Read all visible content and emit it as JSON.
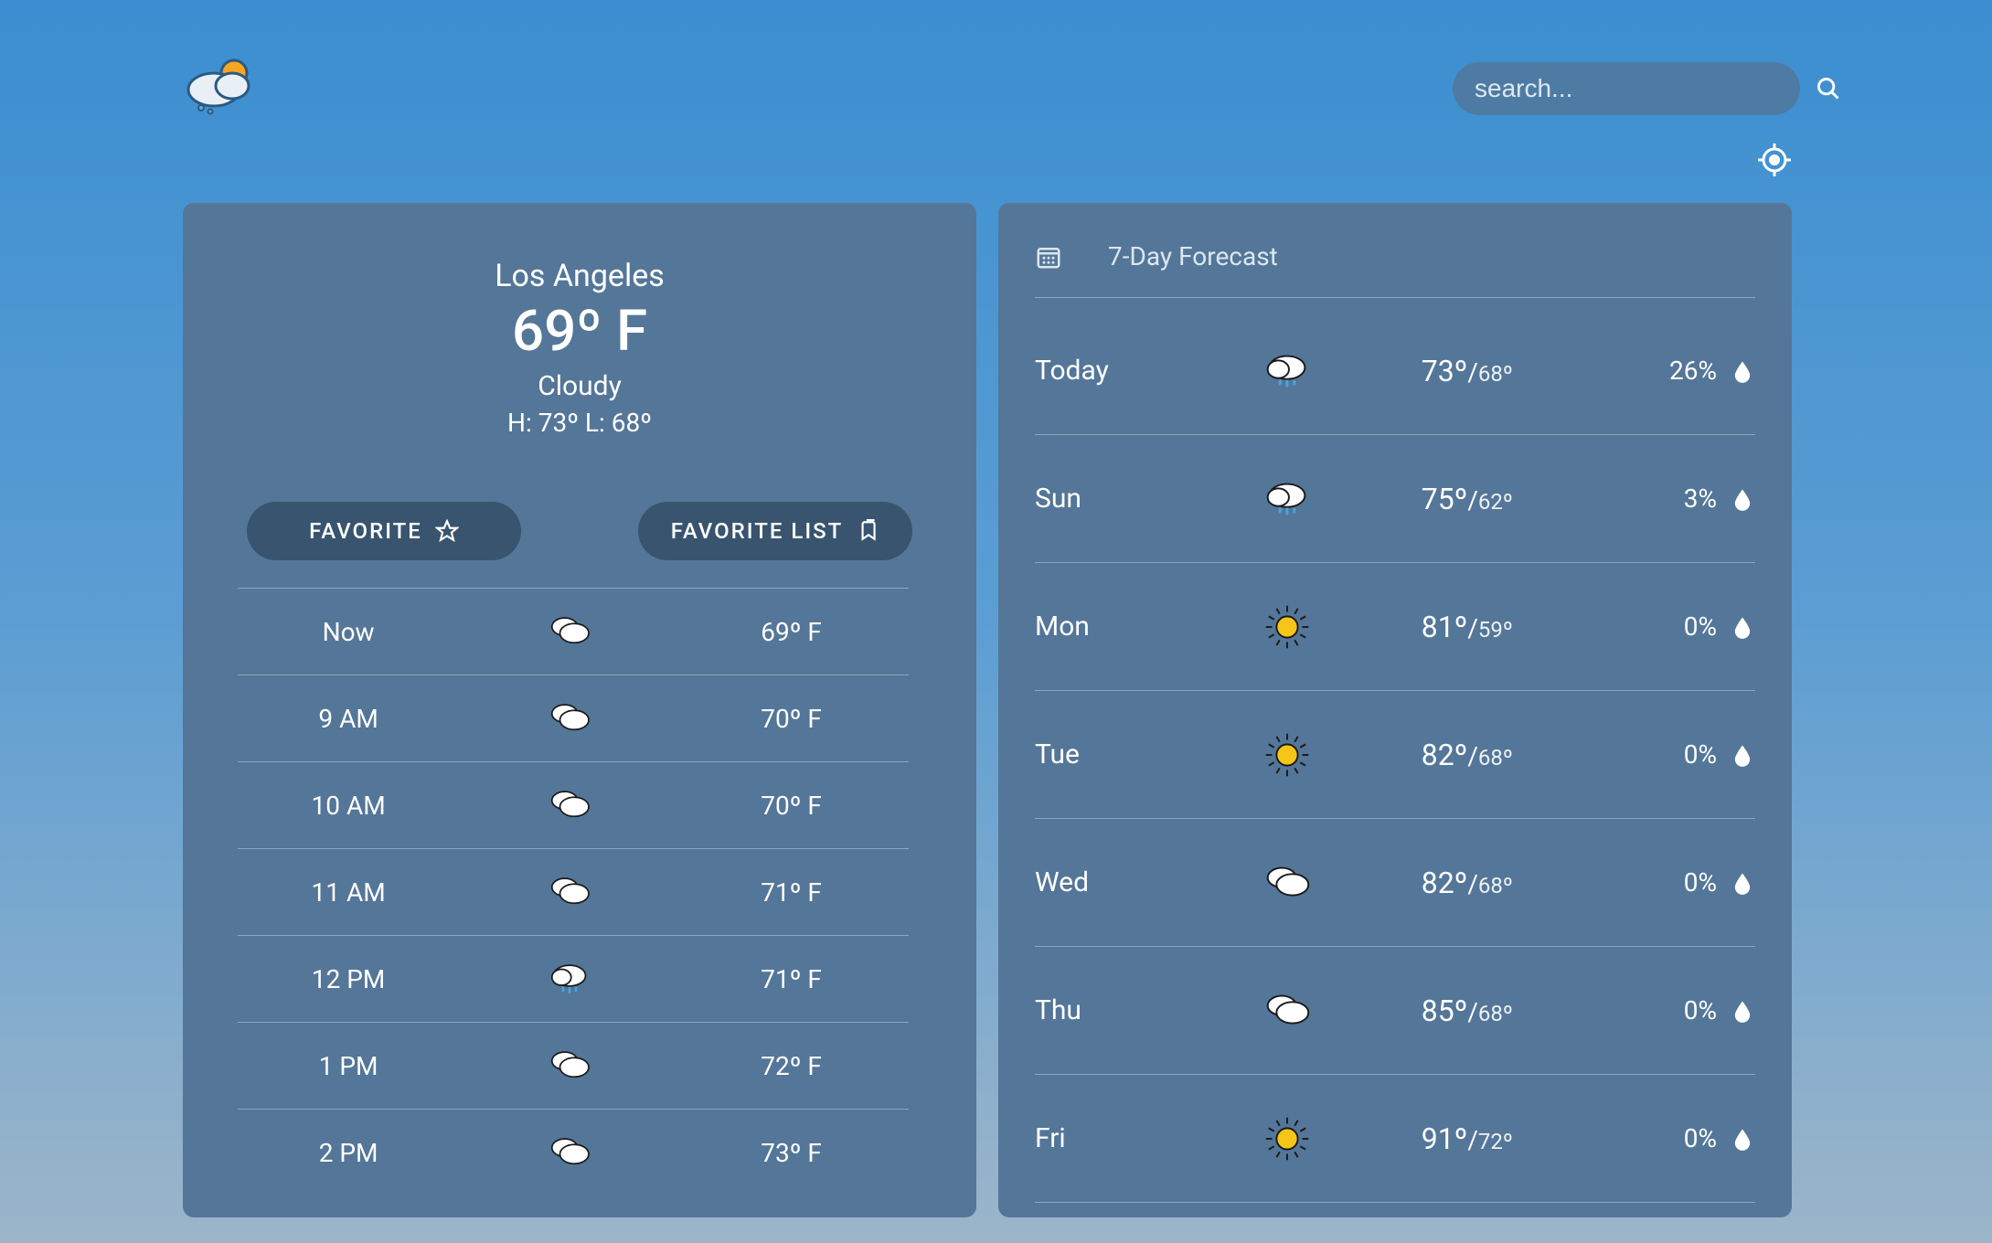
{
  "search": {
    "placeholder": "search..."
  },
  "current": {
    "location": "Los Angeles",
    "temp": "69º F",
    "condition": "Cloudy",
    "hilo": "H: 73º L: 68º"
  },
  "buttons": {
    "favorite": "FAVORITE",
    "favorite_list": "FAVORITE LIST"
  },
  "hourly": [
    {
      "time": "Now",
      "icon": "cloudy",
      "temp": "69º F"
    },
    {
      "time": "9 AM",
      "icon": "cloudy",
      "temp": "70º F"
    },
    {
      "time": "10 AM",
      "icon": "cloudy",
      "temp": "70º F"
    },
    {
      "time": "11 AM",
      "icon": "cloudy",
      "temp": "71º F"
    },
    {
      "time": "12 PM",
      "icon": "rain",
      "temp": "71º F"
    },
    {
      "time": "1 PM",
      "icon": "cloudy",
      "temp": "72º F"
    },
    {
      "time": "2 PM",
      "icon": "cloudy",
      "temp": "73º F"
    }
  ],
  "daily": {
    "title": "7-Day Forecast",
    "items": [
      {
        "day": "Today",
        "icon": "rain",
        "hi": "73º",
        "lo": "68º",
        "precip": "26%"
      },
      {
        "day": "Sun",
        "icon": "rain",
        "hi": "75º",
        "lo": "62º",
        "precip": "3%"
      },
      {
        "day": "Mon",
        "icon": "sunny",
        "hi": "81º",
        "lo": "59º",
        "precip": "0%"
      },
      {
        "day": "Tue",
        "icon": "sunny",
        "hi": "82º",
        "lo": "68º",
        "precip": "0%"
      },
      {
        "day": "Wed",
        "icon": "cloudy",
        "hi": "82º",
        "lo": "68º",
        "precip": "0%"
      },
      {
        "day": "Thu",
        "icon": "cloudy",
        "hi": "85º",
        "lo": "68º",
        "precip": "0%"
      },
      {
        "day": "Fri",
        "icon": "sunny",
        "hi": "91º",
        "lo": "72º",
        "precip": "0%"
      }
    ]
  }
}
